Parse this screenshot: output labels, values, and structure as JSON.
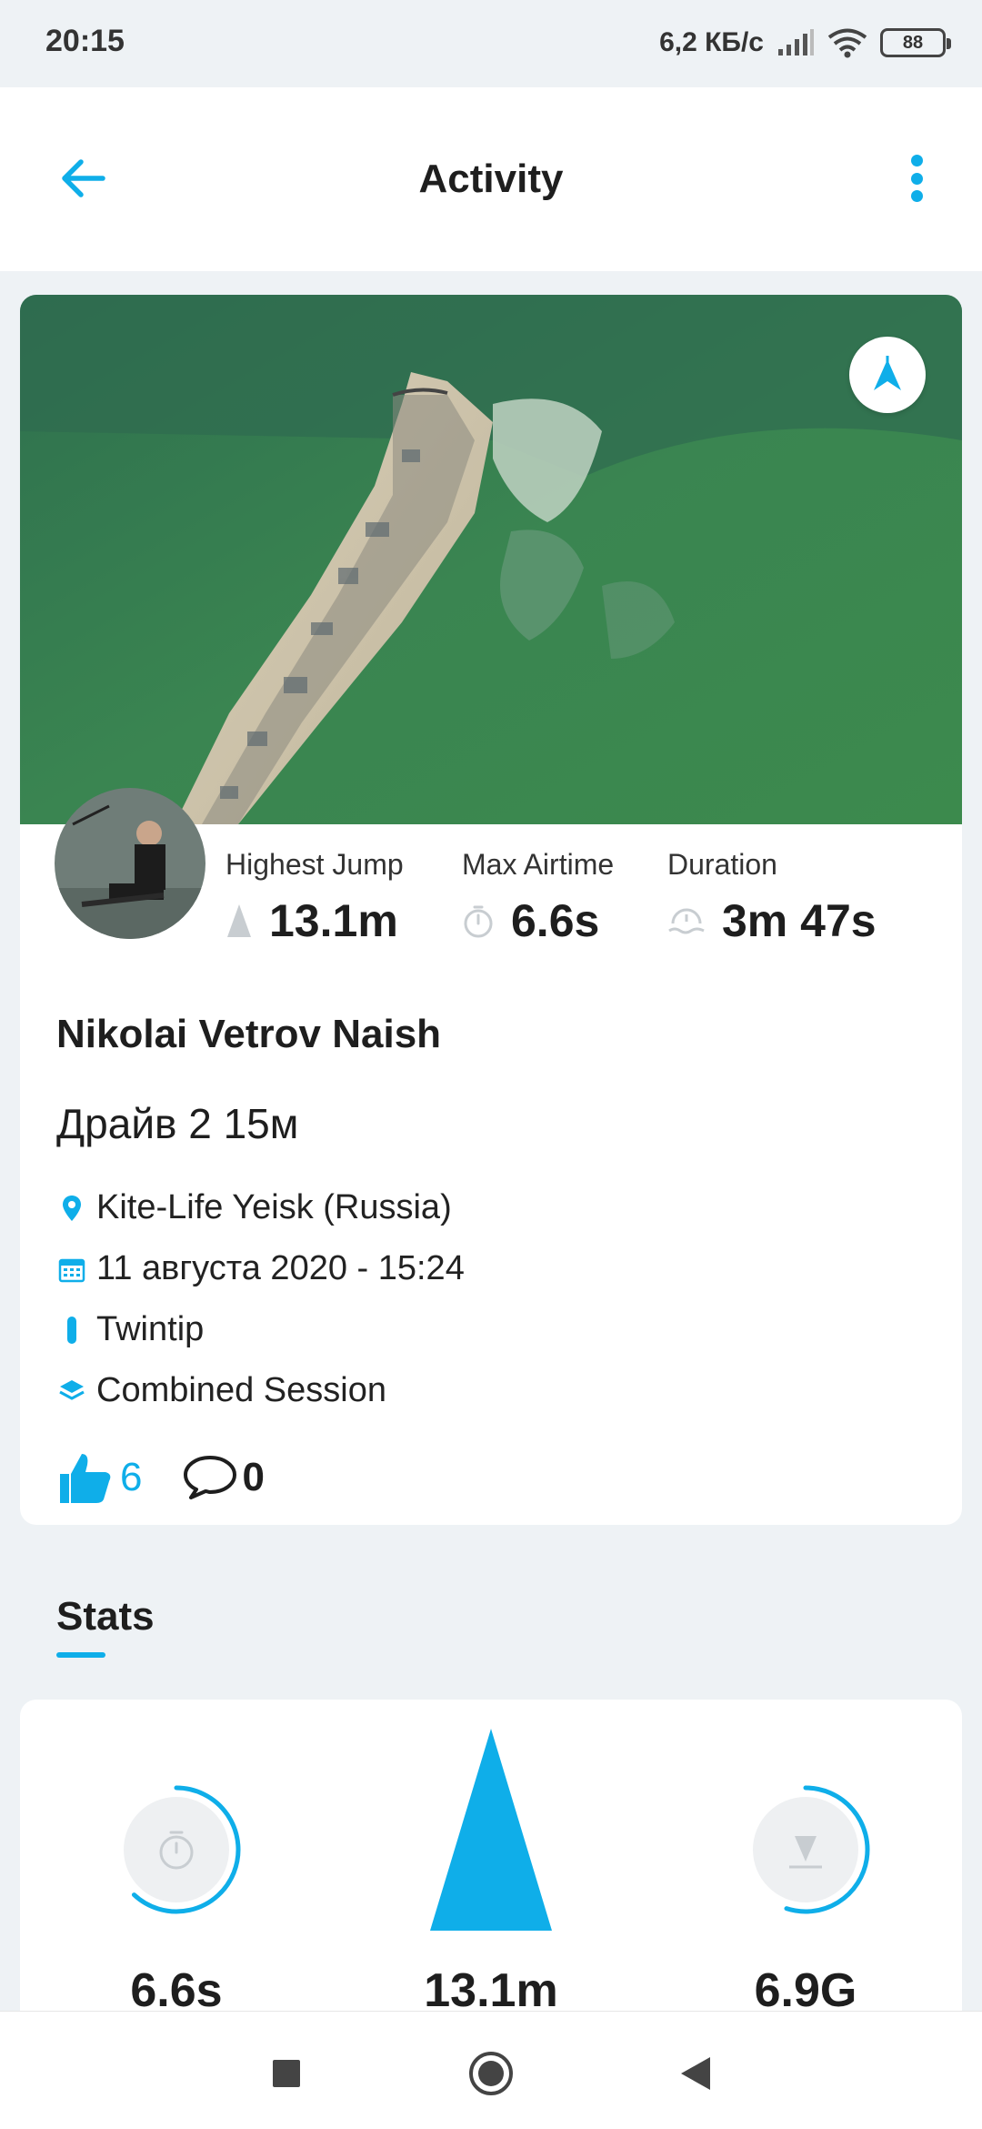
{
  "status_bar": {
    "time": "20:15",
    "net_speed": "6,2 КБ/с",
    "battery": "88"
  },
  "app_bar": {
    "title": "Activity",
    "back_icon": "arrow-left-icon",
    "menu_icon": "more-vertical-icon"
  },
  "activity": {
    "map_icon": "woo-compass-icon",
    "stats": [
      {
        "label": "Highest Jump",
        "value": "13.1m",
        "icon": "jump-triangle-icon"
      },
      {
        "label": "Max Airtime",
        "value": "6.6s",
        "icon": "stopwatch-icon"
      },
      {
        "label": "Duration",
        "value": "3m 47s",
        "icon": "session-duration-icon"
      }
    ],
    "rider_name": "Nikolai Vetrov Naish",
    "session_title": "Драйв 2 15м",
    "location": "Kite-Life Yeisk (Russia)",
    "date": "11 августа 2020 - 15:24",
    "board": "Twintip",
    "session_type": "Combined Session",
    "likes": "6",
    "comments": "0"
  },
  "stats_section": {
    "heading": "Stats",
    "items": [
      {
        "value": "6.6s",
        "icon": "stopwatch-icon",
        "progress": 0.62
      },
      {
        "value": "13.1m",
        "icon": "jump-triangle-icon"
      },
      {
        "value": "6.9G",
        "icon": "landing-icon",
        "progress": 0.55
      }
    ]
  },
  "colors": {
    "accent": "#0faee9",
    "background": "#eef2f5",
    "card": "#ffffff"
  }
}
